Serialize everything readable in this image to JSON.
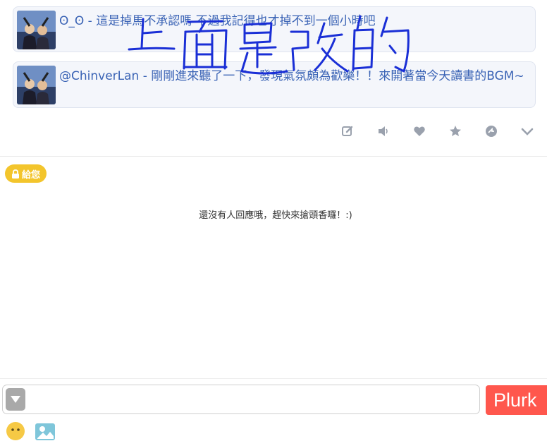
{
  "plurks": [
    {
      "text": "ʘ_ʘ - 這是掉馬不承認嗎 不過我記得也才掉不到一個小時吧"
    },
    {
      "text": "@ChinverLan - 剛剛進來聽了一下，發現氣氛頗為歡樂！！來開著當今天讀書的BGM~"
    }
  ],
  "actions": [
    "edit-icon",
    "mute-icon",
    "like-icon",
    "replurk-icon",
    "share-icon",
    "expand-icon"
  ],
  "badge": {
    "label": "給您"
  },
  "responses": {
    "empty_message": "還沒有人回應哦，趕快來搶頭香囉！:)"
  },
  "composer": {
    "submit_label": "Plurk",
    "placeholder": ""
  },
  "colors": {
    "accent": "#ff574d",
    "badge": "#f3c52c",
    "link": "#3a63b5",
    "scribble": "#1a2fd6"
  }
}
